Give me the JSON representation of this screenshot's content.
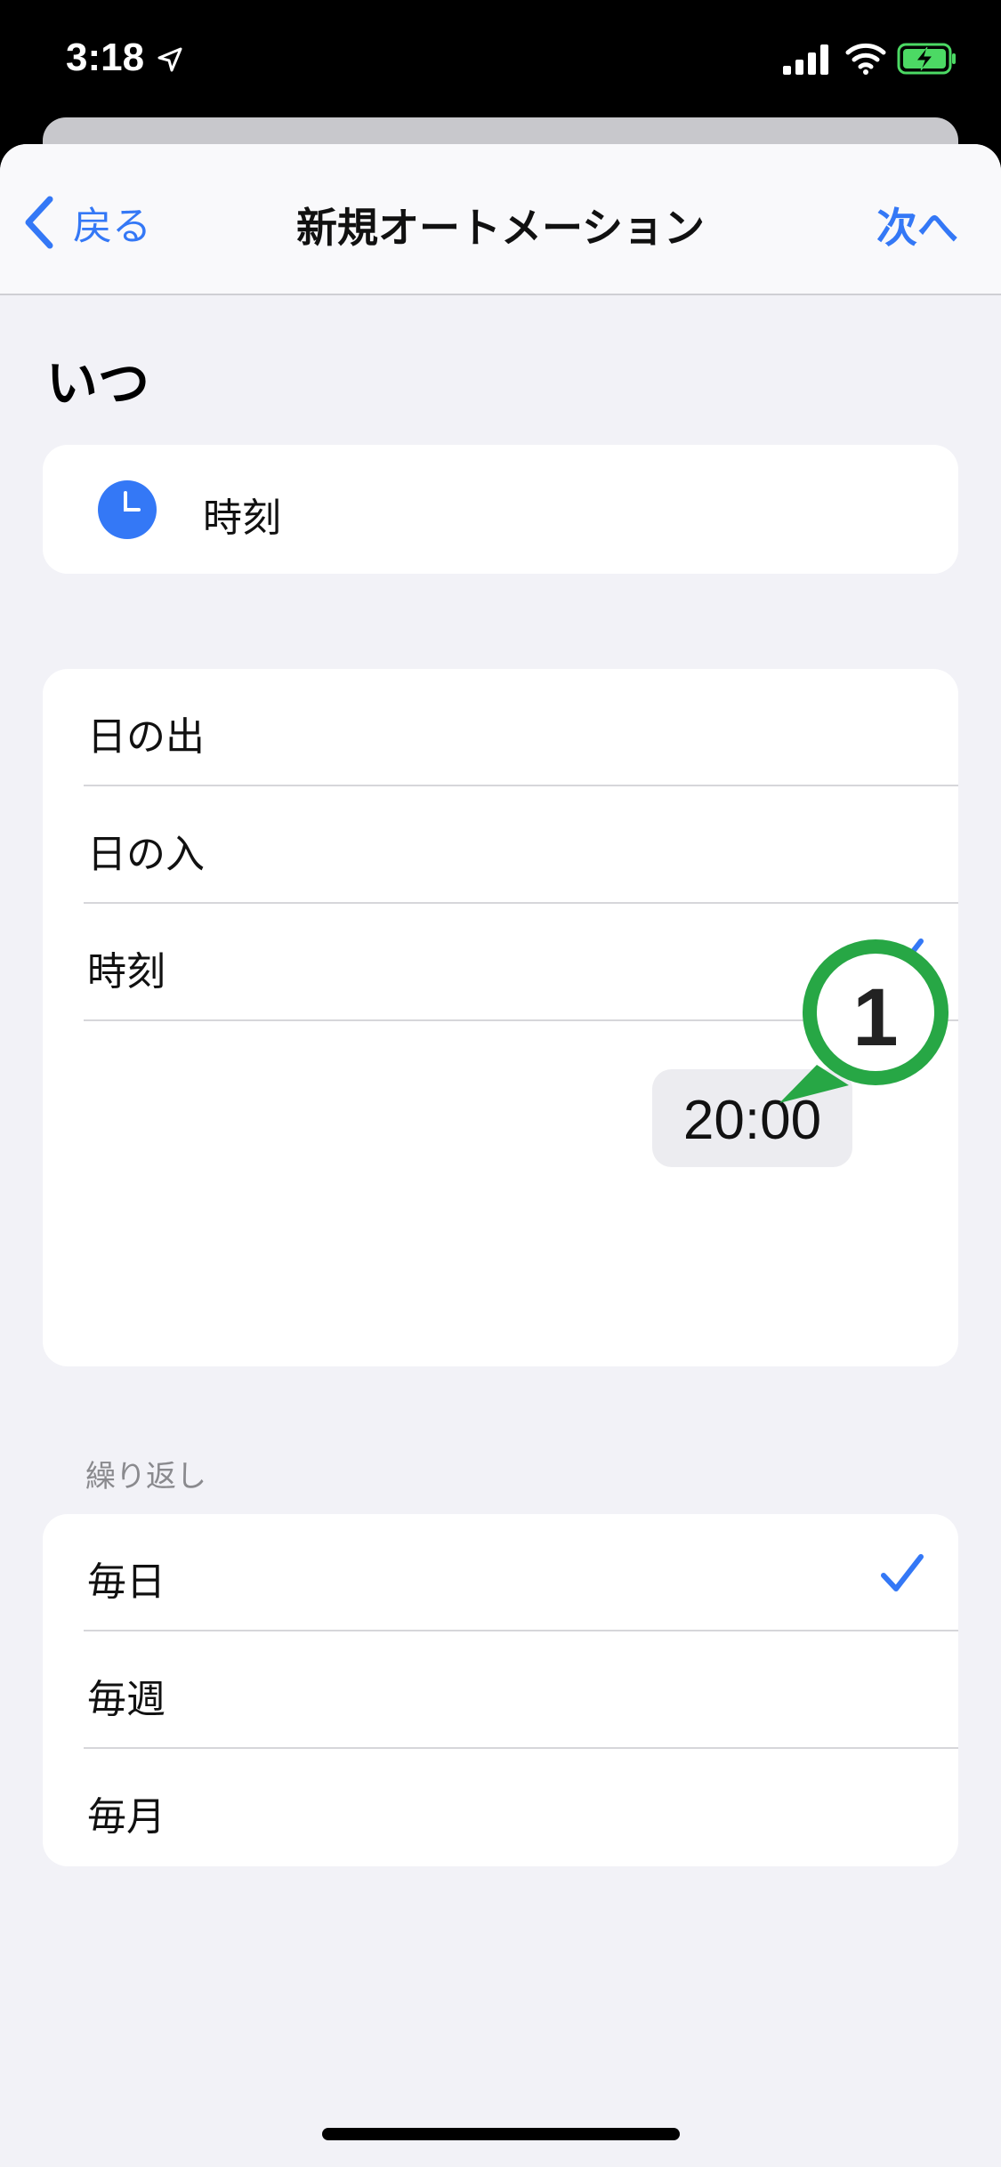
{
  "status_bar": {
    "time": "3:18",
    "location_icon": "location-arrow-icon",
    "signal_icon": "cellular-signal-icon",
    "wifi_icon": "wifi-icon",
    "battery_icon": "battery-charging-icon"
  },
  "nav": {
    "back_label": "戻る",
    "title": "新規オートメーション",
    "next_label": "次へ"
  },
  "when": {
    "heading": "いつ",
    "trigger_label": "時刻",
    "trigger_icon": "clock-icon"
  },
  "time_options": {
    "items": [
      {
        "label": "日の出",
        "selected": false
      },
      {
        "label": "日の入",
        "selected": false
      },
      {
        "label": "時刻",
        "selected": true
      }
    ],
    "time_value": "20:00"
  },
  "callout": {
    "number": "1",
    "color": "#27a745"
  },
  "repeat": {
    "caption": "繰り返し",
    "items": [
      {
        "label": "毎日",
        "selected": true
      },
      {
        "label": "毎週",
        "selected": false
      },
      {
        "label": "毎月",
        "selected": false
      }
    ]
  },
  "colors": {
    "accent": "#3478f6",
    "background": "#f2f2f7"
  }
}
